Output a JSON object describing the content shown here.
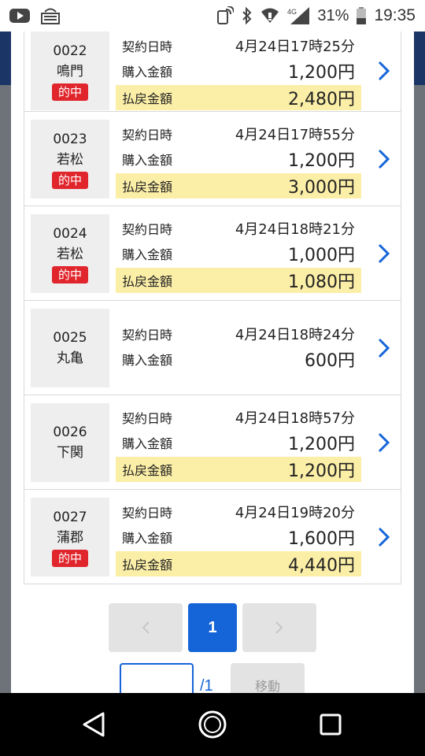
{
  "status_bar": {
    "network": "4G",
    "battery": "31%",
    "time": "19:35"
  },
  "labels": {
    "contract_time": "契約日時",
    "purchase_amount": "購入金額",
    "payout_amount": "払戻金額",
    "hit": "的中"
  },
  "records": [
    {
      "id": "0022",
      "venue": "鳴門",
      "hit": true,
      "datetime": "4月24日17時25分",
      "purchase": "1,200円",
      "payout": "2,480円"
    },
    {
      "id": "0023",
      "venue": "若松",
      "hit": true,
      "datetime": "4月24日17時55分",
      "purchase": "1,200円",
      "payout": "3,000円"
    },
    {
      "id": "0024",
      "venue": "若松",
      "hit": true,
      "datetime": "4月24日18時21分",
      "purchase": "1,000円",
      "payout": "1,080円"
    },
    {
      "id": "0025",
      "venue": "丸亀",
      "hit": false,
      "datetime": "4月24日18時24分",
      "purchase": "600円",
      "payout": ""
    },
    {
      "id": "0026",
      "venue": "下関",
      "hit": false,
      "datetime": "4月24日18時57分",
      "purchase": "1,200円",
      "payout": "1,200円"
    },
    {
      "id": "0027",
      "venue": "蒲郡",
      "hit": true,
      "datetime": "4月24日19時20分",
      "purchase": "1,600円",
      "payout": "4,440円"
    }
  ],
  "pagination": {
    "current_page": "1",
    "total": "/1",
    "page_input": "",
    "move_label": "移動"
  }
}
